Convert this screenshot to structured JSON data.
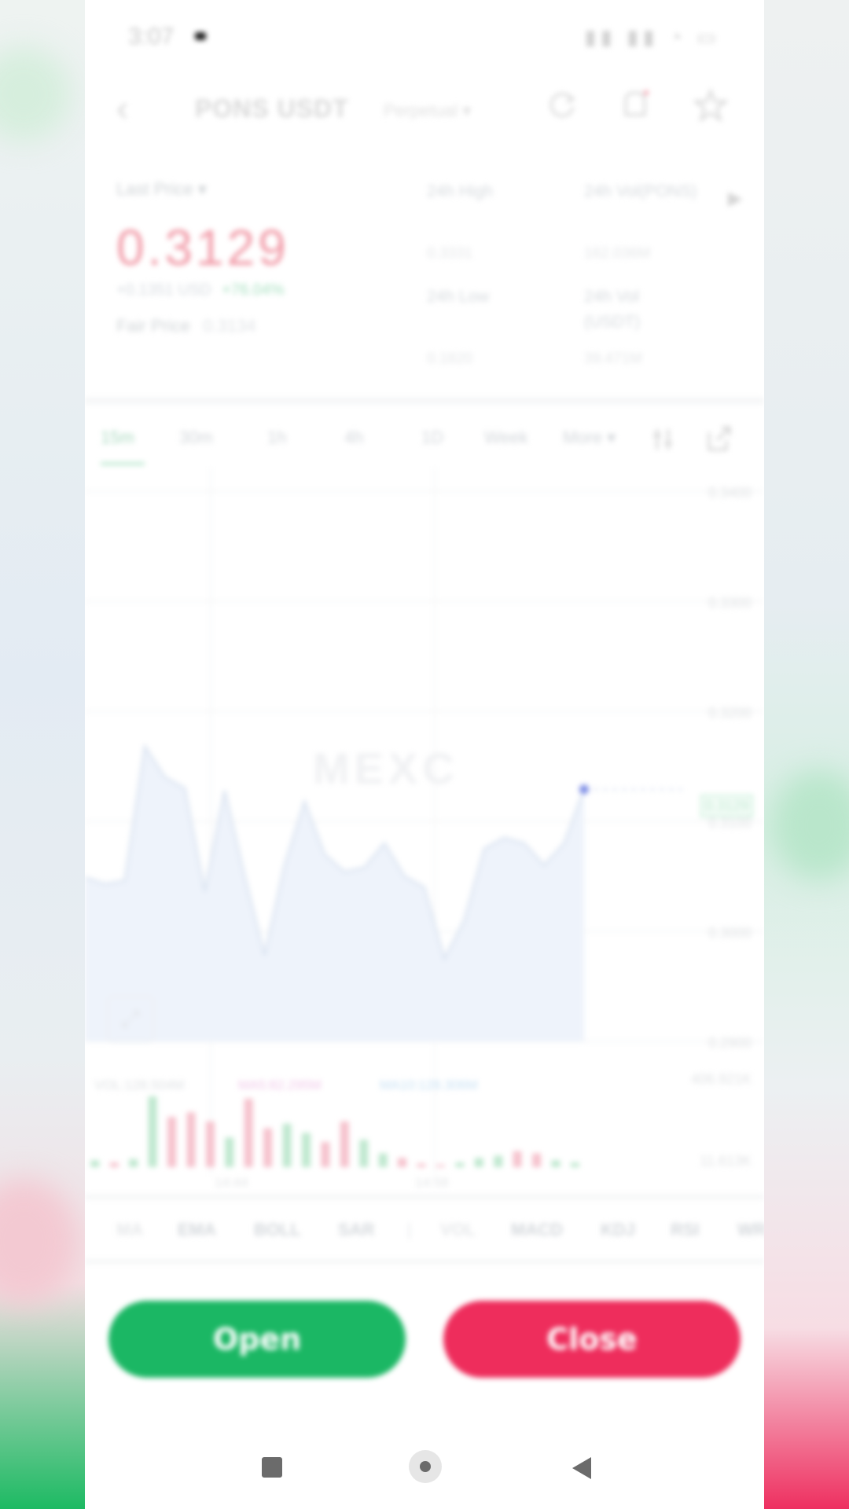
{
  "status": {
    "time": "3:07",
    "icons": "▮▮ ▮▮ ◔ ▭"
  },
  "header": {
    "pair": "PONS USDT",
    "sub": "Perpetual ▾",
    "back_icon": "chevron-left-icon",
    "refresh_icon": "refresh-icon",
    "alert_icon": "bell-icon",
    "favorite_icon": "star-icon"
  },
  "ticker": {
    "last_price_label": "Last Price ▾",
    "price": "0.3129",
    "change": "+0.1351 USD",
    "change_pct": "+76.04%",
    "fair_price_label": "Fair Price",
    "fair_price": "0.3134",
    "high_label": "24h High",
    "high_value": "0.3331",
    "vol_label": "24h Vol(PONS)",
    "vol_value": "162.036M",
    "low_label": "24h Low",
    "low_value": "0.1820",
    "vol_usdt_label": "24h Vol (USDT)",
    "vol_usdt_value": "39.471M"
  },
  "timeframes": [
    "15m",
    "30m",
    "1h",
    "4h",
    "1D",
    "Week",
    "More ▾"
  ],
  "chart": {
    "watermark": "MEXC",
    "y_ticks": [
      "0.3400",
      "0.3300",
      "0.3200",
      "0.3100",
      "0.3000",
      "0.2900"
    ],
    "last_tag": "0.3129",
    "indicator_vol": "VOL:128.504M",
    "indicator_ma5": "MA5:82.295M",
    "indicator_ma10": "MA10:128.306M",
    "vol_axis_top": "406.921K",
    "vol_axis_bottom": "11.613K",
    "x_ticks": [
      "14:44",
      "14:58"
    ]
  },
  "chart_data": {
    "type": "area",
    "series": [
      {
        "values": [
          0.3049,
          0.3043,
          0.3046,
          0.3168,
          0.314,
          0.313,
          0.3036,
          0.3128,
          0.305,
          0.2978,
          0.306,
          0.3118,
          0.307,
          0.3054,
          0.3058,
          0.308,
          0.305,
          0.304,
          0.2975,
          0.301,
          0.3075,
          0.3085,
          0.308,
          0.306,
          0.308,
          0.3129
        ]
      }
    ],
    "ylim": [
      0.29,
      0.34
    ],
    "volumes": [
      6,
      4,
      7,
      62,
      44,
      48,
      40,
      26,
      60,
      34,
      38,
      30,
      22,
      40,
      24,
      12,
      8,
      3,
      2,
      4,
      8,
      10,
      14,
      12,
      6,
      4
    ]
  },
  "indicators": [
    "MA",
    "EMA",
    "BOLL",
    "SAR",
    "VOL",
    "MACD",
    "KDJ",
    "RSI",
    "WR"
  ],
  "actions": {
    "open": "Open",
    "close": "Close"
  }
}
